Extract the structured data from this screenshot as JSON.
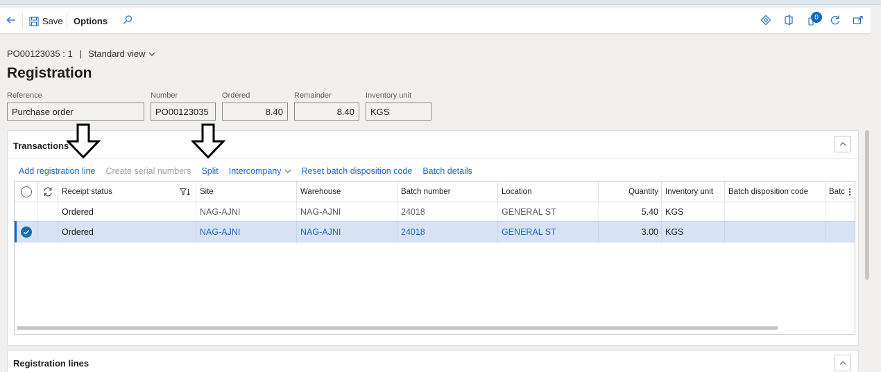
{
  "toolbar": {
    "back_icon": "back-arrow-icon",
    "save_label": "Save",
    "options_label": "Options",
    "search_icon": "search-icon",
    "notification_count": "0",
    "accent_color": "#2266c4"
  },
  "breadcrumb": {
    "record": "PO00123035 : 1",
    "separator": "|",
    "view": "Standard view"
  },
  "page_title": "Registration",
  "header_fields": [
    {
      "label": "Reference",
      "value": "Purchase order"
    },
    {
      "label": "Number",
      "value": "PO00123035"
    },
    {
      "label": "Ordered",
      "value": "8.40"
    },
    {
      "label": "Remainder",
      "value": "8.40"
    },
    {
      "label": "Inventory unit",
      "value": "KGS"
    }
  ],
  "transactions": {
    "title": "Transactions",
    "actions": {
      "add_registration_line": "Add registration line",
      "create_serial_numbers": "Create serial numbers",
      "split": "Split",
      "intercompany": "Intercompany",
      "reset_batch_disposition_code": "Reset batch disposition code",
      "batch_details": "Batch details"
    },
    "columns": {
      "receipt_status": "Receipt status",
      "site": "Site",
      "warehouse": "Warehouse",
      "batch_number": "Batch number",
      "location": "Location",
      "quantity": "Quantity",
      "inventory_unit": "Inventory unit",
      "batch_disposition_code": "Batch disposition code",
      "batch_truncated": "Batc"
    },
    "rows": [
      {
        "receipt_status": "Ordered",
        "site": "NAG-AJNI",
        "warehouse": "NAG-AJNI",
        "batch_number": "24018",
        "location": "GENERAL ST",
        "quantity": "5.40",
        "inventory_unit": "KGS",
        "batch_disposition_code": "",
        "selected": false
      },
      {
        "receipt_status": "Ordered",
        "site": "NAG-AJNI",
        "warehouse": "NAG-AJNI",
        "batch_number": "24018",
        "location": "GENERAL ST",
        "quantity": "3.00",
        "inventory_unit": "KGS",
        "batch_disposition_code": "",
        "selected": true
      }
    ]
  },
  "registration_lines": {
    "title": "Registration lines"
  }
}
